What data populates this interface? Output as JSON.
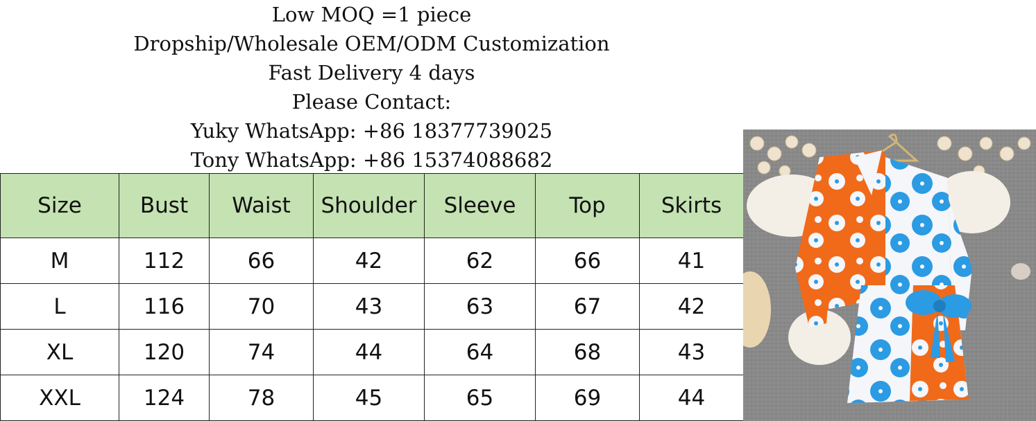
{
  "header": {
    "lines": [
      "Low MOQ =1 piece",
      "Dropship/Wholesale OEM/ODM Customization",
      "Fast Delivery 4 days",
      "Please Contact:",
      "Yuky WhatsApp: +86 18377739025",
      "Tony WhatsApp: +86 15374088682"
    ]
  },
  "size_table": {
    "columns": [
      "Size",
      "Bust",
      "Waist",
      "Shoulder",
      "Sleeve",
      "Top",
      "Skirts"
    ],
    "rows": [
      [
        "M",
        "112",
        "66",
        "42",
        "62",
        "66",
        "41"
      ],
      [
        "L",
        "116",
        "70",
        "43",
        "63",
        "67",
        "42"
      ],
      [
        "XL",
        "120",
        "74",
        "44",
        "64",
        "68",
        "43"
      ],
      [
        "XXL",
        "124",
        "78",
        "45",
        "65",
        "69",
        "44"
      ]
    ],
    "header_color": "#c4e2b2"
  },
  "product_photo": {
    "colors": {
      "background": "#8a8a8a",
      "orange": "#f06a1a",
      "blue": "#2b9be3",
      "white": "#f4f6fa",
      "fur": "#f3efe6"
    }
  }
}
